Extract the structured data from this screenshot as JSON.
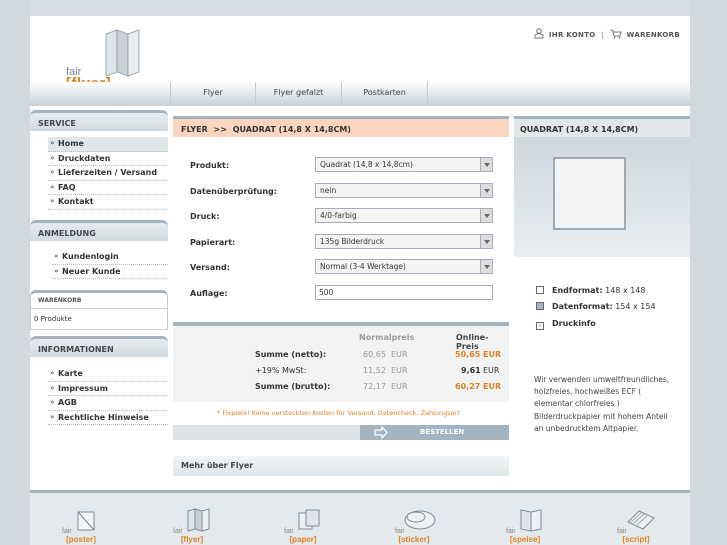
{
  "logo": {
    "fair": "fair",
    "brand": "[flyer]"
  },
  "toplinks": {
    "account": "IHR KONTO",
    "cart": "WARENKORB"
  },
  "nav": {
    "tabs": [
      "Flyer",
      "Flyer gefalzt",
      "Postkarten"
    ]
  },
  "service": {
    "title": "SERVICE",
    "items": [
      "Home",
      "Druckdaten",
      "Lieferzeiten / Versand",
      "FAQ",
      "Kontakt"
    ]
  },
  "anmeldung": {
    "title": "ANMELDUNG",
    "items": [
      "Kundenlogin",
      "Neuer Kunde"
    ]
  },
  "warenkorb": {
    "title": "WARENKORB",
    "content": "0 Produkte"
  },
  "informationen": {
    "title": "INFORMATIONEN",
    "items": [
      "Karte",
      "Impressum",
      "AGB",
      "Rechtliche Hinweise"
    ]
  },
  "main": {
    "title": "FLYER",
    "sep": ">>",
    "subtitle": "QUADRAT (14,8 X 14,8CM)",
    "form": [
      {
        "label": "Produkt:",
        "value": "Quadrat (14,8 x 14,8cm)",
        "type": "select"
      },
      {
        "label": "Datenüberprüfung:",
        "value": "nein",
        "type": "select"
      },
      {
        "label": "Druck:",
        "value": "4/0-farbig",
        "type": "select"
      },
      {
        "label": "Papierart:",
        "value": "135g Bilderdruck",
        "type": "select"
      },
      {
        "label": "Versand:",
        "value": "Normal (3-4 Werktage)",
        "type": "select"
      },
      {
        "label": "Auflage:",
        "value": "500",
        "type": "input"
      }
    ],
    "prices": {
      "col_normal": "Normalpreis",
      "col_online": "Online-Preis",
      "rows": [
        {
          "label": "Summe (netto):",
          "normal": "60,65",
          "online": "50,65",
          "cur": "EUR"
        },
        {
          "label": "+19% MwSt:",
          "normal": "11,52",
          "online": "9,61",
          "cur": "EUR"
        },
        {
          "label": "Summe (brutto):",
          "normal": "72,17",
          "online": "60,27",
          "cur": "EUR"
        }
      ]
    },
    "note": "* Fixpreis! Keine versteckten Kosten für Versand, Datencheck, Zahlungsart",
    "order_button": "BESTELLEN",
    "more": "Mehr über Flyer"
  },
  "right": {
    "title": "QUADRAT (14,8 X 14,8CM)",
    "endformat_label": "Endformat:",
    "endformat_value": "148 x 148",
    "datenformat_label": "Datenformat:",
    "datenformat_value": "154 x 154",
    "druckinfo": "Druckinfo",
    "description": "Wir verwenden umweltfreundliches, holzfreies, hochweißes ECF ( elementar chlorfreies ) Bilderdruckpapier mit hohem Anteil an unbedrucktem Altpapier."
  },
  "footer": [
    {
      "fair": "fair",
      "name": "[poster]"
    },
    {
      "fair": "fair",
      "name": "[flyer]"
    },
    {
      "fair": "fair",
      "name": "[paper]"
    },
    {
      "fair": "fair",
      "name": "[sticker]"
    },
    {
      "fair": "fair",
      "name": "[speise]"
    },
    {
      "fair": "fair",
      "name": "[script]"
    }
  ],
  "colors": {
    "accent": "#e4801f",
    "header_bar": "#a3b3bf",
    "main_header": "#fbd5bd"
  }
}
